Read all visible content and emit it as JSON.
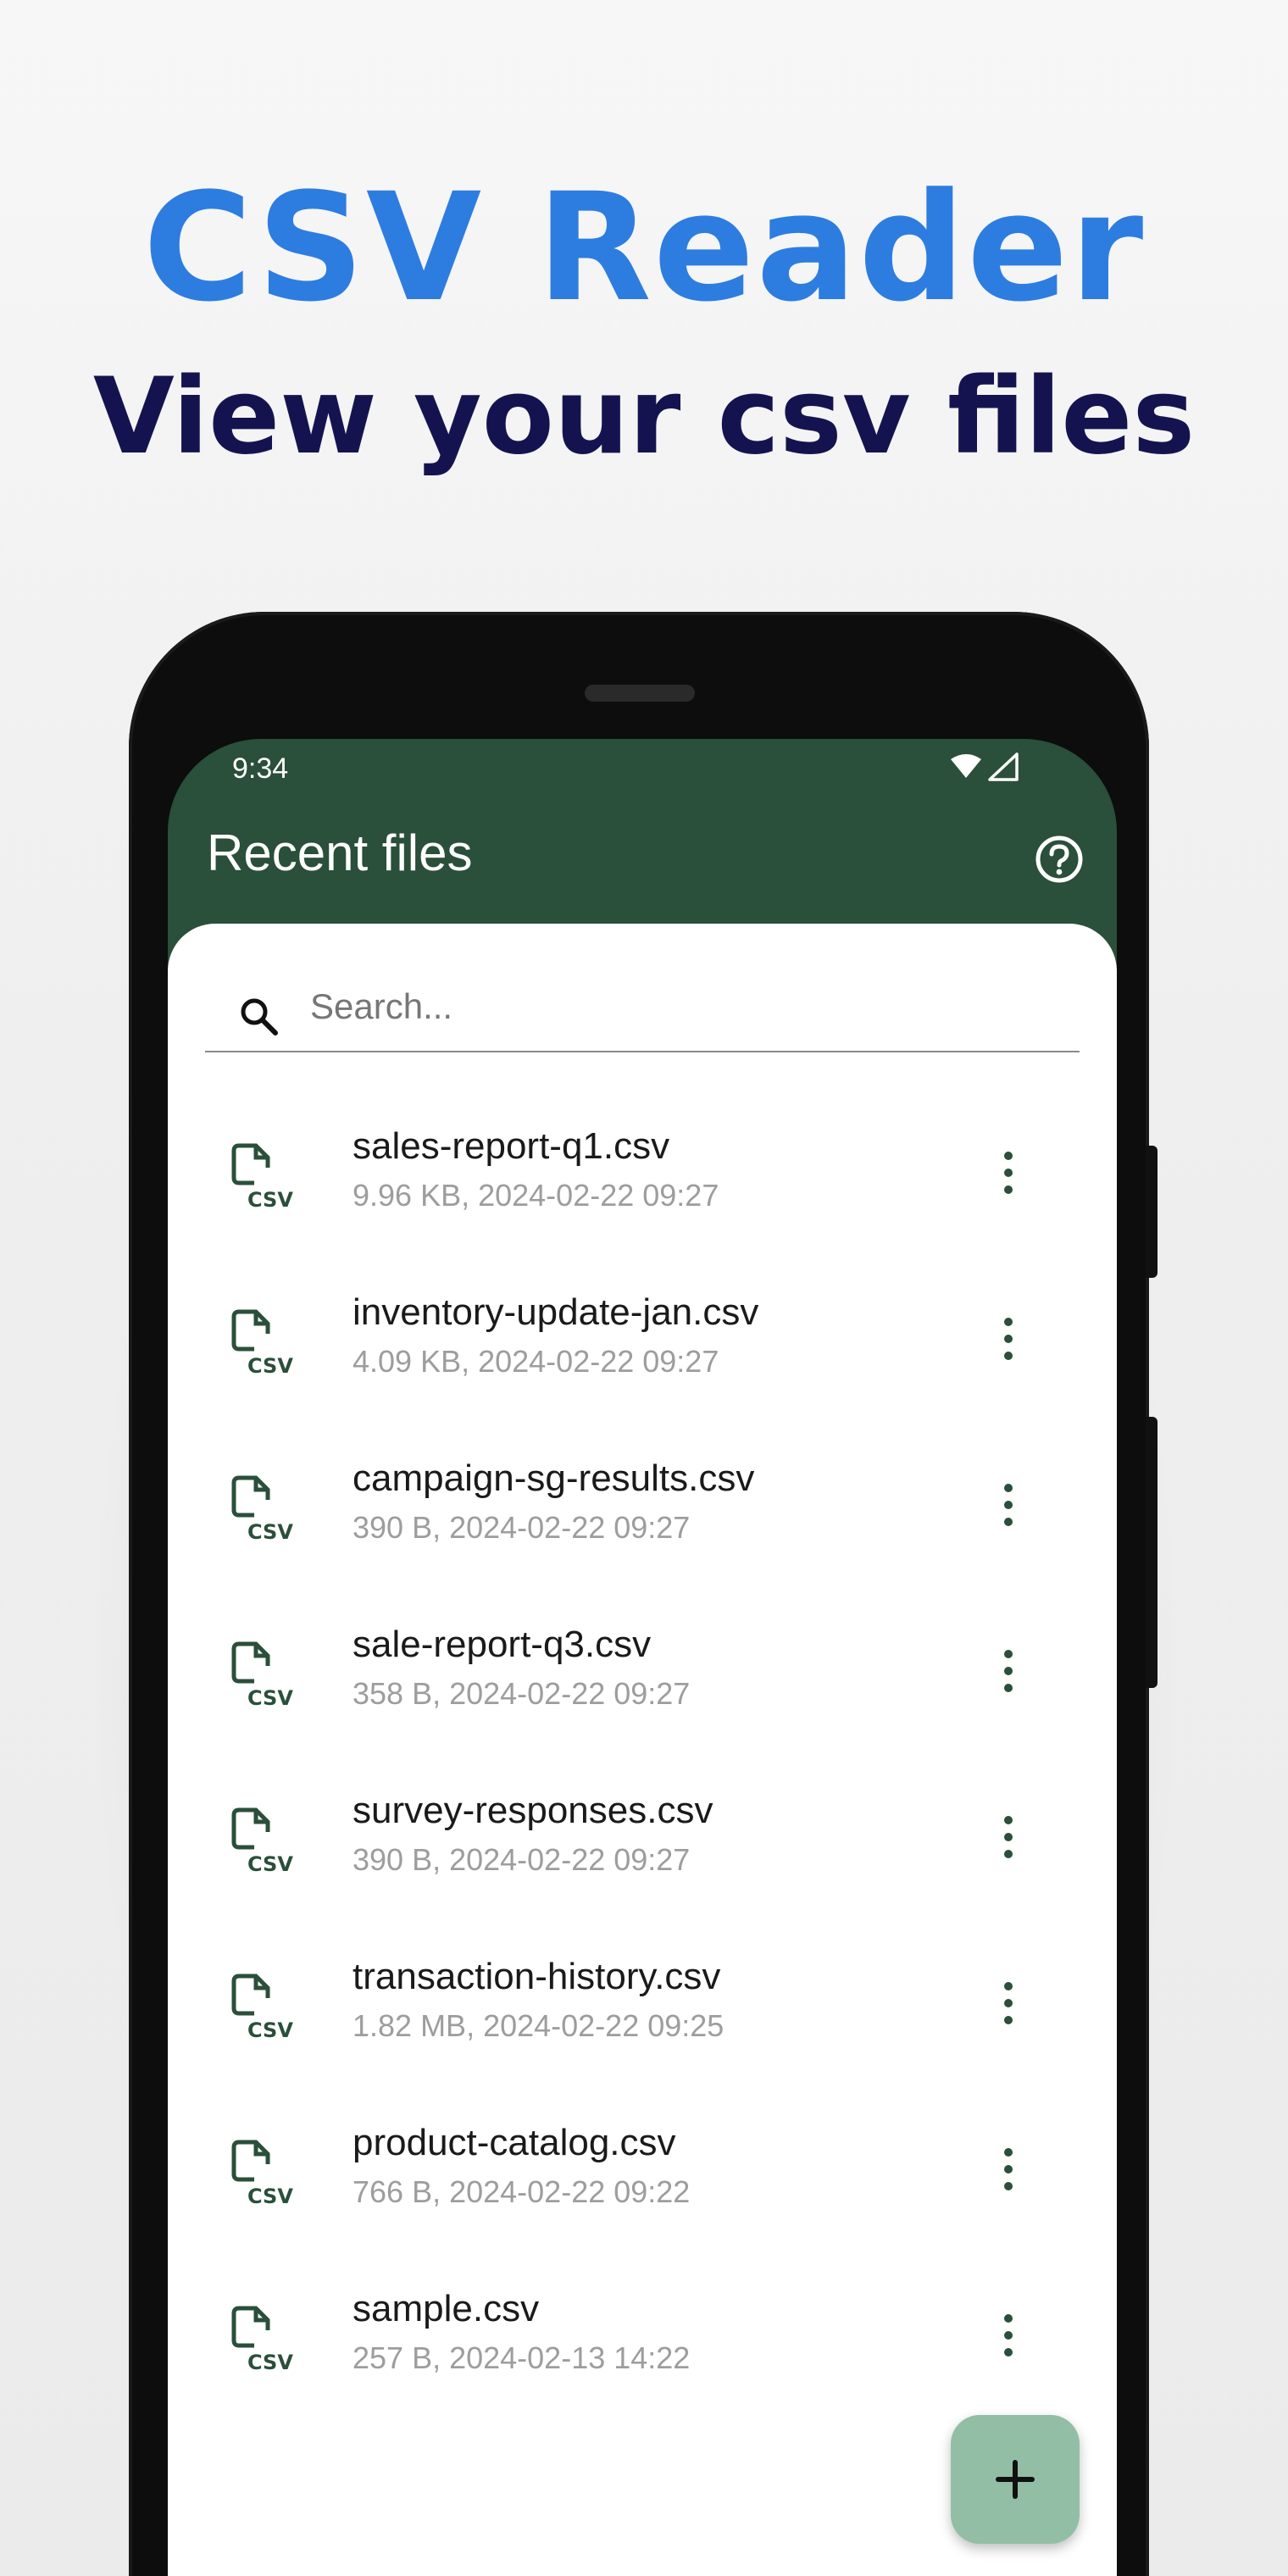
{
  "hero": {
    "title": "CSV Reader",
    "subtitle": "View your csv files"
  },
  "status_bar": {
    "time": "9:34",
    "icons": [
      "wifi-icon",
      "cell-signal-icon"
    ]
  },
  "app_bar": {
    "title": "Recent files",
    "help_icon": "help-circle-icon"
  },
  "search": {
    "placeholder": "Search...",
    "value": ""
  },
  "files": [
    {
      "name": "sales-report-q1.csv",
      "meta": "9.96 KB, 2024-02-22 09:27"
    },
    {
      "name": "inventory-update-jan.csv",
      "meta": "4.09 KB, 2024-02-22 09:27"
    },
    {
      "name": "campaign-sg-results.csv",
      "meta": "390 B, 2024-02-22 09:27"
    },
    {
      "name": "sale-report-q3.csv",
      "meta": "358 B, 2024-02-22 09:27"
    },
    {
      "name": "survey-responses.csv",
      "meta": "390 B, 2024-02-22 09:27"
    },
    {
      "name": "transaction-history.csv",
      "meta": "1.82 MB, 2024-02-22 09:25"
    },
    {
      "name": "product-catalog.csv",
      "meta": "766 B, 2024-02-22 09:22"
    },
    {
      "name": "sample.csv",
      "meta": "257 B, 2024-02-13 14:22"
    }
  ],
  "fab": {
    "icon": "plus-icon"
  },
  "colors": {
    "hero_title": "#2d7de0",
    "hero_subtitle": "#15134f",
    "app_bar": "#2a4f3a",
    "file_icon": "#2a4f3a",
    "fab": "#93bea6"
  }
}
